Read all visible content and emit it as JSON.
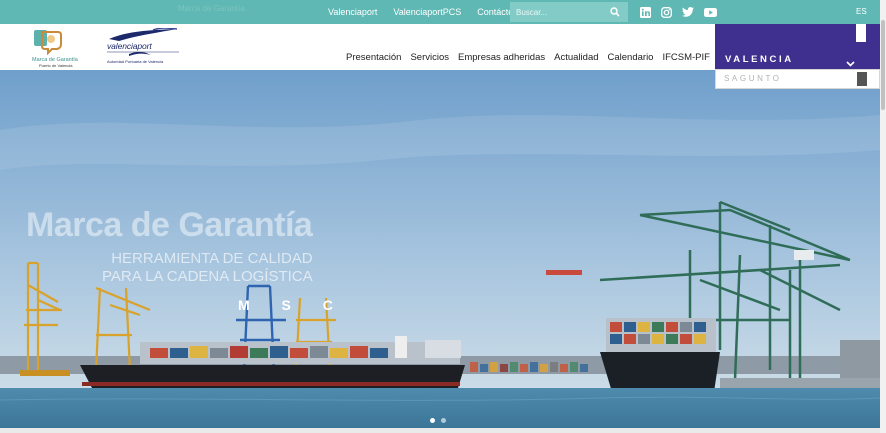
{
  "topbar": {
    "ghost_text": "Marca de Garantía",
    "links": [
      "Valenciaport",
      "ValenciaportPCS",
      "Contáctenos"
    ],
    "search": {
      "placeholder": "Buscar...",
      "value": ""
    },
    "social_icons": [
      "linkedin-icon",
      "instagram-icon",
      "twitter-icon",
      "youtube-icon"
    ],
    "language": "ES"
  },
  "header": {
    "logo_marca": {
      "line1": "Marca de Garantía",
      "line2": "Puerto de Valencia"
    },
    "logo_valenciaport": {
      "line1": "valenciaport",
      "line2": "Autoridad Portuaria de Valencia"
    },
    "nav": [
      "Presentación",
      "Servicios",
      "Empresas adheridas",
      "Actualidad",
      "Calendario",
      "IFCSM-PIF"
    ]
  },
  "port_selector": {
    "active": "VALENCIA",
    "other": "SAGUNTO"
  },
  "hero": {
    "title": "Marca de Garantía",
    "subtitle_line1": "HERRAMIENTA DE CALIDAD",
    "subtitle_line2": "PARA LA CADENA LOGÍSTICA",
    "ship_name": "M S C",
    "slides": 2,
    "active_slide": 1
  },
  "colors": {
    "topbar": "#5fb8b3",
    "port_selector": "#3f2f8e",
    "sky": "#7fa9cf",
    "water": "#3f7c9f"
  }
}
